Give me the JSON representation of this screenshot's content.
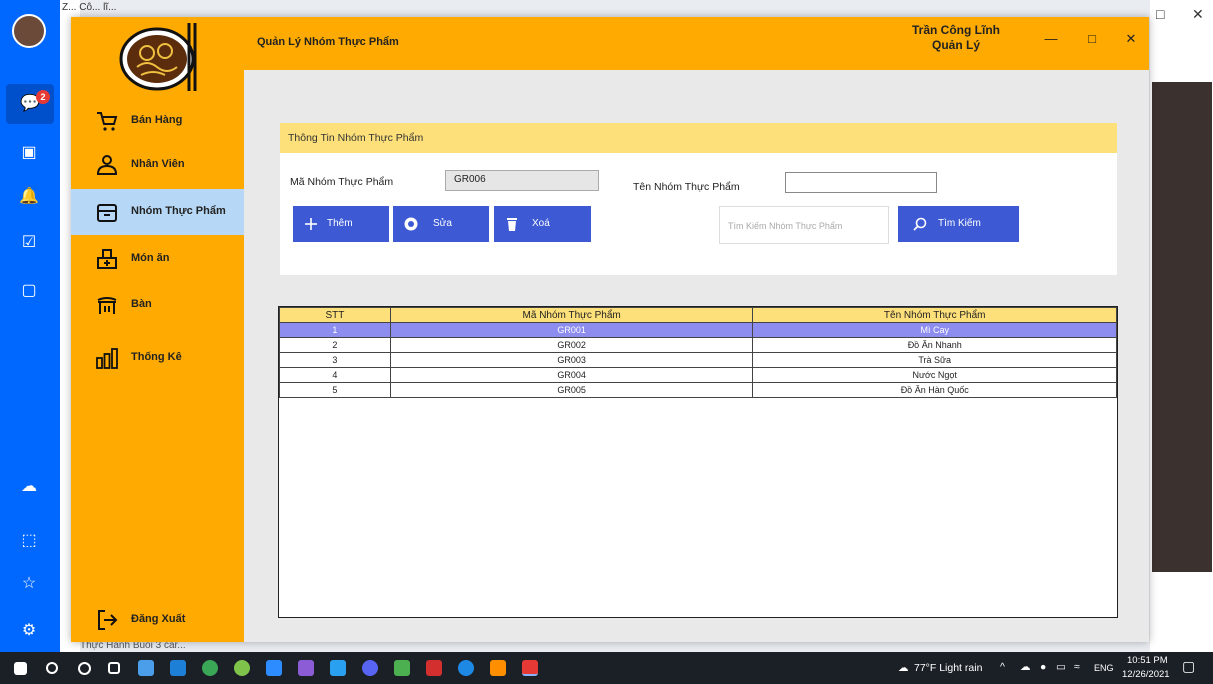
{
  "background": {
    "title_partial": "Z... Cô... lĩ...",
    "bottom_item": "Thực Hành Buổi 3 car...",
    "badge_count": "2"
  },
  "window": {
    "title": "Quản Lý Nhóm Thực Phẩm",
    "user_name": "Trần Công Lĩnh",
    "user_role": "Quản Lý",
    "minimize": "—",
    "maximize": "□",
    "close": "✕"
  },
  "sidebar": {
    "items": [
      {
        "label": "Bán Hàng",
        "icon": "cart-icon"
      },
      {
        "label": "Nhân Viên",
        "icon": "user-icon"
      },
      {
        "label": "Nhóm Thực Phẩm",
        "icon": "box-icon"
      },
      {
        "label": "Món ăn",
        "icon": "food-icon"
      },
      {
        "label": "Bàn",
        "icon": "table-icon"
      },
      {
        "label": "Thống Kê",
        "icon": "chart-icon"
      }
    ],
    "logout": "Đăng Xuất",
    "active_index": 2
  },
  "form": {
    "header": "Thông Tin Nhóm Thực Phẩm",
    "code_label": "Mã Nhóm Thực Phẩm",
    "code_value": "GR006",
    "name_label": "Tên Nhóm Thực Phẩm",
    "name_value": "",
    "add_button": "Thêm",
    "edit_button": "Sửa",
    "delete_button": "Xoá",
    "search_placeholder": "Tìm Kiếm Nhóm Thực Phẩm",
    "search_button": "Tìm Kiếm"
  },
  "table": {
    "columns": [
      "STT",
      "Mã Nhóm Thực Phẩm",
      "Tên Nhóm Thực Phẩm"
    ],
    "rows": [
      [
        "1",
        "GR001",
        "Mì Cay"
      ],
      [
        "2",
        "GR002",
        "Đồ Ăn Nhanh"
      ],
      [
        "3",
        "GR003",
        "Trà Sữa"
      ],
      [
        "4",
        "GR004",
        "Nước Ngọt"
      ],
      [
        "5",
        "GR005",
        "Đồ Ăn Hàn Quốc"
      ]
    ],
    "selected_row": 0
  },
  "taskbar": {
    "weather": "77°F  Light rain",
    "lang": "ENG",
    "time": "10:51 PM",
    "date": "12/26/2021"
  },
  "colors": {
    "accent_orange": "#ffaa00",
    "button_blue": "#3d5ad4",
    "header_yellow": "#fde07a",
    "selected_row": "#8d8df0",
    "active_nav": "#b6d7f5"
  }
}
